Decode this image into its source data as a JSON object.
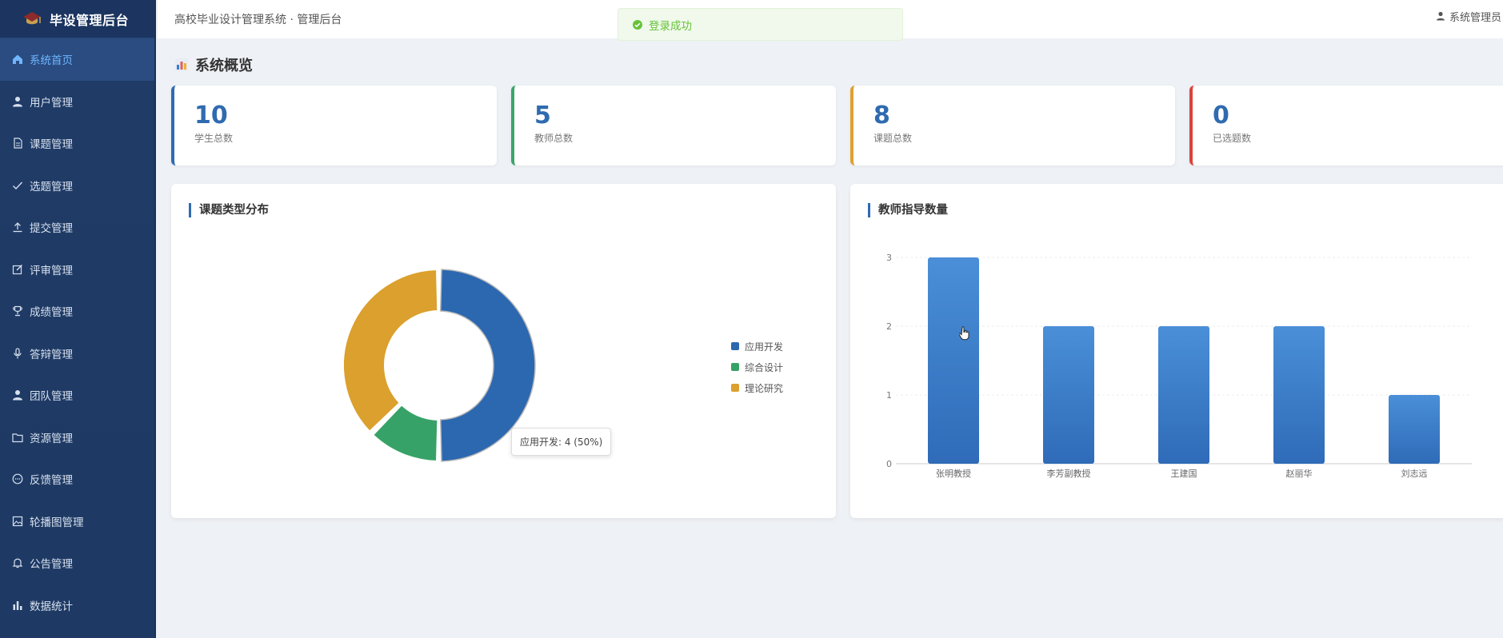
{
  "brand": {
    "title": "毕设管理后台"
  },
  "header": {
    "title": "高校毕业设计管理系统 · 管理后台",
    "user": "系统管理员"
  },
  "toast": {
    "message": "登录成功"
  },
  "sidebar": {
    "items": [
      {
        "label": "系统首页",
        "icon": "home-icon",
        "active": true
      },
      {
        "label": "用户管理",
        "icon": "user-icon"
      },
      {
        "label": "课题管理",
        "icon": "document-icon"
      },
      {
        "label": "选题管理",
        "icon": "check-icon"
      },
      {
        "label": "提交管理",
        "icon": "upload-icon"
      },
      {
        "label": "评审管理",
        "icon": "edit-icon"
      },
      {
        "label": "成绩管理",
        "icon": "trophy-icon"
      },
      {
        "label": "答辩管理",
        "icon": "microphone-icon"
      },
      {
        "label": "团队管理",
        "icon": "team-icon"
      },
      {
        "label": "资源管理",
        "icon": "folder-icon"
      },
      {
        "label": "反馈管理",
        "icon": "chat-icon"
      },
      {
        "label": "轮播图管理",
        "icon": "image-icon"
      },
      {
        "label": "公告管理",
        "icon": "bell-icon"
      },
      {
        "label": "数据统计",
        "icon": "bar-chart-icon"
      }
    ]
  },
  "overview": {
    "title": "系统概览",
    "stats": [
      {
        "value": "10",
        "label": "学生总数"
      },
      {
        "value": "5",
        "label": "教师总数"
      },
      {
        "value": "8",
        "label": "课题总数"
      },
      {
        "value": "0",
        "label": "已选题数"
      }
    ]
  },
  "pie_panel": {
    "title": "课题类型分布",
    "tooltip": "应用开发: 4 (50%)"
  },
  "bar_panel": {
    "title": "教师指导数量"
  },
  "colors": {
    "blue": "#2f6bb0",
    "green": "#3aa56a",
    "orange": "#e0a030",
    "bar": "#3a80cc"
  },
  "chart_data": [
    {
      "type": "pie",
      "title": "课题类型分布",
      "categories": [
        "应用开发",
        "综合设计",
        "理论研究"
      ],
      "values": [
        4,
        1,
        3
      ],
      "colors": [
        "#2c68b0",
        "#37a267",
        "#dba02d"
      ],
      "legend": "right"
    },
    {
      "type": "bar",
      "title": "教师指导数量",
      "categories": [
        "张明教授",
        "李芳副教授",
        "王建国",
        "赵丽华",
        "刘志远"
      ],
      "values": [
        3,
        2,
        2,
        2,
        1
      ],
      "ylim": [
        0,
        3
      ],
      "yticks": [
        0,
        1,
        2,
        3
      ],
      "grid": true
    }
  ]
}
